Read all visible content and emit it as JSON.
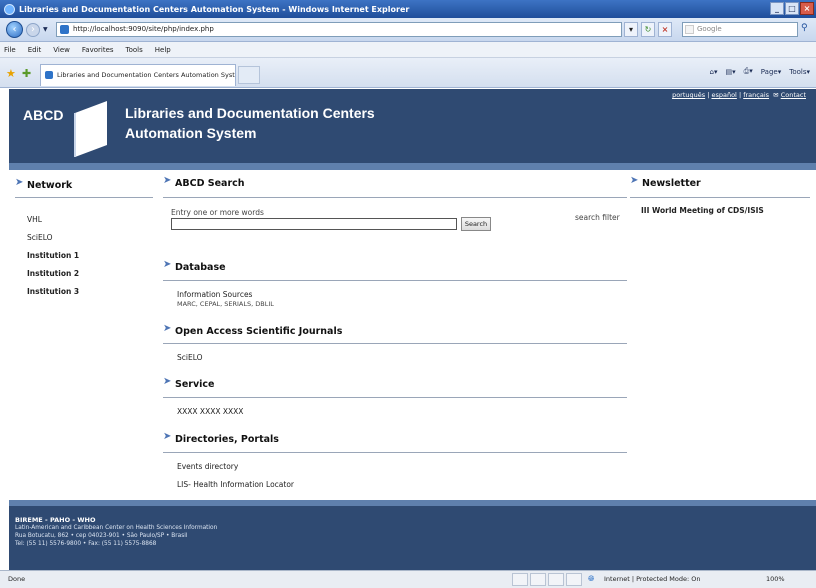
{
  "window": {
    "title": "Libraries and Documentation Centers Automation System - Windows Internet Explorer"
  },
  "address_bar": {
    "url": "http://localhost:9090/site/php/index.php",
    "search_placeholder": "Google"
  },
  "menu": [
    "File",
    "Edit",
    "View",
    "Favorites",
    "Tools",
    "Help"
  ],
  "tab": {
    "label": "Libraries and Documentation Centers Automation Syst..."
  },
  "command_bar": {
    "page": "Page",
    "tools": "Tools"
  },
  "header": {
    "logo": "ABCD",
    "title_line1": "Libraries and Documentation Centers",
    "title_line2": "Automation System",
    "links": [
      "português",
      "español",
      "français"
    ],
    "contact": "Contact"
  },
  "sidebar": {
    "title": "Network",
    "items": [
      "VHL",
      "SciELO",
      "Institution 1",
      "Institution 2",
      "Institution 3"
    ]
  },
  "main": {
    "search": {
      "title": "ABCD Search",
      "label": "Entry one or more words",
      "button": "Search",
      "filter": "search filter"
    },
    "database": {
      "title": "Database",
      "item": "Information Sources",
      "subitem": "MARC, CEPAL, SERIALS, DBLIL"
    },
    "journals": {
      "title": "Open Access Scientific Journals",
      "item": "SciELO"
    },
    "service": {
      "title": "Service",
      "item": "XXXX XXXX XXXX"
    },
    "directories": {
      "title": "Directories, Portals",
      "items": [
        "Events directory",
        "LIS- Health Information Locator"
      ]
    }
  },
  "newsletter": {
    "title": "Newsletter",
    "item": "III World Meeting of CDS/ISIS"
  },
  "footer": {
    "line1": "BIREME - PAHO - WHO",
    "line2": "Latin-American and Caribbean Center on Health Sciences Information",
    "line3": "Rua Botucatu, 862 • cep 04023-901 • São Paulo/SP • Brasil",
    "line4": "Tel: (55 11) 5576-9800 • Fax: (55 11) 5575-8868"
  },
  "status": {
    "left": "Done",
    "zone": "Internet | Protected Mode: On",
    "zoom": "100%"
  }
}
